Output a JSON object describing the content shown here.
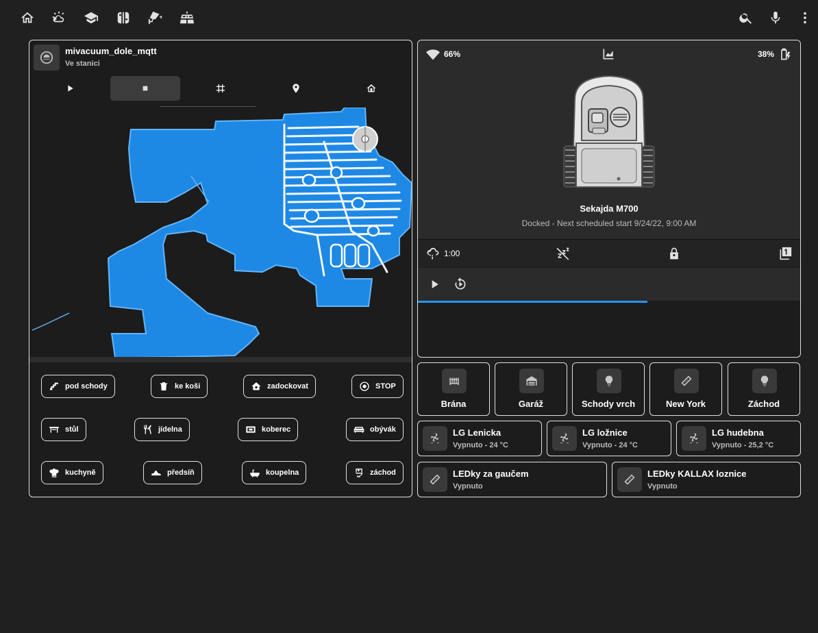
{
  "topbar": {
    "nav_icons": [
      "home-icon",
      "weather-icon",
      "school-icon",
      "nintendo-switch-icon",
      "cctv-icon",
      "solar-panel-icon"
    ],
    "action_icons": [
      "search-icon",
      "microphone-icon",
      "more-vert-icon"
    ]
  },
  "vacuum": {
    "name": "mivacuum_dole_mqtt",
    "state": "Ve stanici",
    "controls": [
      "play-icon",
      "stop-icon",
      "zone-icon",
      "location-icon",
      "return-home-icon"
    ],
    "active_control": "stop",
    "buttons": {
      "pod_schody": "pod schody",
      "ke_kosi": "ke koši",
      "zadockovat": "zadockovat",
      "stop": "STOP",
      "stul": "stůl",
      "jidelna": "jídelna",
      "koberec": "koberec",
      "obyvak": "obývák",
      "kuchyne": "kuchyně",
      "predsin": "předsíň",
      "koupelna": "koupelna",
      "zachod": "záchod"
    }
  },
  "mower": {
    "wifi": "66%",
    "battery": "38%",
    "name": "Sekajda M700",
    "status": "Docked - Next scheduled start 9/24/22, 9:00 AM",
    "rain_delay": "1:00",
    "progress_fraction": 0.6,
    "accent": "#2196f3"
  },
  "tiles": {
    "brana": "Brána",
    "garaz": "Garáž",
    "schody_vrch": "Schody vrch",
    "new_york": "New York",
    "zachod": "Záchod"
  },
  "climate": {
    "lenicka": {
      "name": "LG Lenicka",
      "state": "Vypnuto - 24 °C"
    },
    "loznice": {
      "name": "LG ložnice",
      "state": "Vypnuto - 24 °C"
    },
    "hudebna": {
      "name": "LG hudebna",
      "state": "Vypnuto - 25,2 °C"
    }
  },
  "leds": {
    "gauc": {
      "name": "LEDky za gaučem",
      "state": "Vypnuto"
    },
    "kallax": {
      "name": "LEDky KALLAX loznice",
      "state": "Vypnuto"
    }
  },
  "colors": {
    "map_blue": "#1e88e5",
    "map_edge": "#64b5f6",
    "background": "#202020"
  }
}
